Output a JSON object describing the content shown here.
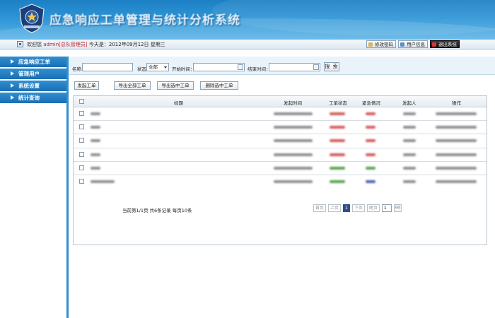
{
  "header": {
    "system_title": "应急响应工单管理与统计分析系统"
  },
  "infobar": {
    "welcome": "欢迎您",
    "user": "admin[总队管理员]",
    "today": "今天是：2012年09月12日  星期三",
    "buttons": [
      "修改密码",
      "用户信息",
      "退出系统"
    ]
  },
  "sidebar": {
    "items": [
      {
        "label": "应急响应工单"
      },
      {
        "label": "管理用户"
      },
      {
        "label": "系统设置"
      },
      {
        "label": "统计查询"
      }
    ]
  },
  "search": {
    "name_label": "名称:",
    "name_value": "",
    "status_label": "状态",
    "status_value": "全部",
    "start_label": "开始时间：",
    "start_value": "",
    "end_label": "结束时间：",
    "end_value": "",
    "search_button": "搜 索"
  },
  "actions": [
    "发起工单",
    "导出全部工单",
    "导出选中工单",
    "删除选中工单"
  ],
  "table": {
    "columns": [
      "标题",
      "发起时间",
      "工单状态",
      "紧急情况",
      "发起人",
      "操作"
    ],
    "rows": [
      {
        "status_color": "red",
        "urgency_color": "red"
      },
      {
        "status_color": "red",
        "urgency_color": "red"
      },
      {
        "status_color": "red",
        "urgency_color": "red"
      },
      {
        "status_color": "red",
        "urgency_color": "red"
      },
      {
        "status_color": "green",
        "urgency_color": "green"
      },
      {
        "status_color": "green",
        "urgency_color": "blue"
      }
    ]
  },
  "pager": {
    "info": "当前第1/1页  共6条记录  每页10条",
    "first": "首页",
    "prev": "上页",
    "current": "1",
    "next": "下页",
    "last": "尾页",
    "goto_value": "1",
    "go": "GO"
  },
  "colors": {
    "brand": "#1d7fc4",
    "menu": "#2f8fd0",
    "accent_red": "#c0202a"
  }
}
